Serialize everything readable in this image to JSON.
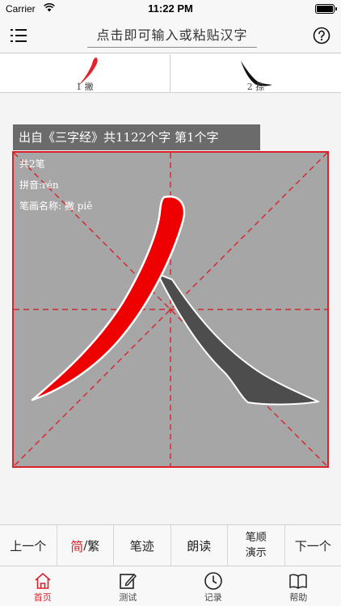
{
  "status_bar": {
    "carrier": "Carrier",
    "time": "11:22 PM"
  },
  "nav": {
    "search_placeholder": "点击即可输入或粘贴汉字"
  },
  "strokes": [
    {
      "label": "1 撇",
      "color": "#d9232b"
    },
    {
      "label": "2 捺",
      "color": "#111111"
    }
  ],
  "source_title": "出自《三字经》共1122个字 第1个字",
  "character_info": {
    "stroke_count": "共2笔",
    "pinyin": "拼音:rén",
    "stroke_name": "笔画名称: 撇 piě"
  },
  "colors": {
    "accent": "#d9232b",
    "grid_bg": "#a6a6a6",
    "stroke_active": "#ee0000",
    "stroke_other": "#4d4d4d"
  },
  "toolbar": {
    "prev": "上一个",
    "simplified": "简",
    "separator": "/",
    "traditional": "繁",
    "trace": "笔迹",
    "read_aloud": "朗读",
    "order_line1": "笔顺",
    "order_line2": "演示",
    "next": "下一个"
  },
  "tabs": [
    {
      "label": "首页",
      "icon": "home-icon"
    },
    {
      "label": "测试",
      "icon": "edit-icon"
    },
    {
      "label": "记录",
      "icon": "clock-icon"
    },
    {
      "label": "帮助",
      "icon": "book-icon"
    }
  ]
}
